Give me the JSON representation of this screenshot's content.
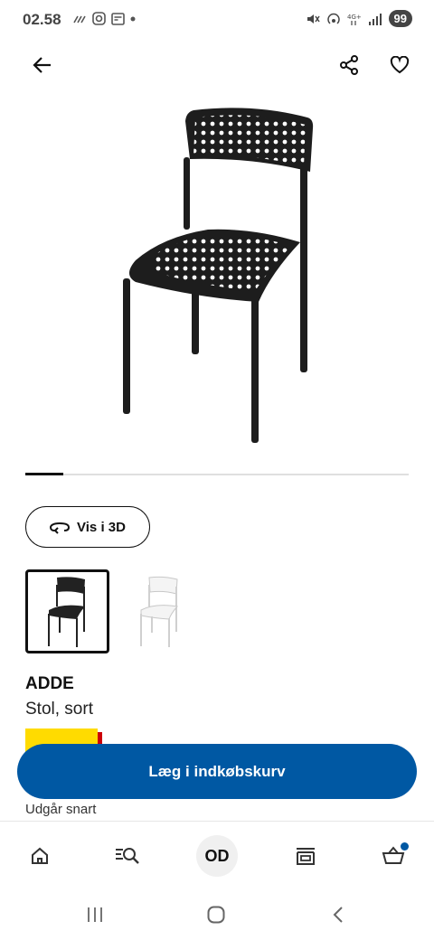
{
  "status_bar": {
    "time": "02.58",
    "left_icons": [
      "missed-call-icon",
      "instagram-icon",
      "news-icon",
      "dot-icon"
    ],
    "right_icons": [
      "mute-icon",
      "hotspot-icon",
      "4g-icon",
      "signal-icon"
    ],
    "battery": "99"
  },
  "top_bar": {
    "back_icon": "arrow-left-icon",
    "share_icon": "share-icon",
    "favorite_icon": "heart-icon"
  },
  "gallery": {
    "progress": 0.1
  },
  "view_3d": {
    "label": "Vis i 3D",
    "icon": "rotate-3d-icon"
  },
  "variants": [
    {
      "color": "sort",
      "selected": true
    },
    {
      "color": "hvid",
      "selected": false
    }
  ],
  "product": {
    "name": "ADDE",
    "description": "Stol, sort"
  },
  "cta": {
    "label": "Læg i indkøbskurv"
  },
  "availability_notice": "Udgår snart",
  "bottom_nav": {
    "items": [
      "home-icon",
      "search-icon",
      "profile-avatar",
      "store-icon",
      "cart-icon"
    ],
    "avatar_initials": "OD"
  },
  "colors": {
    "brand_blue": "#0058a3",
    "price_yellow": "#ffdb00",
    "price_red": "#cc0008"
  }
}
